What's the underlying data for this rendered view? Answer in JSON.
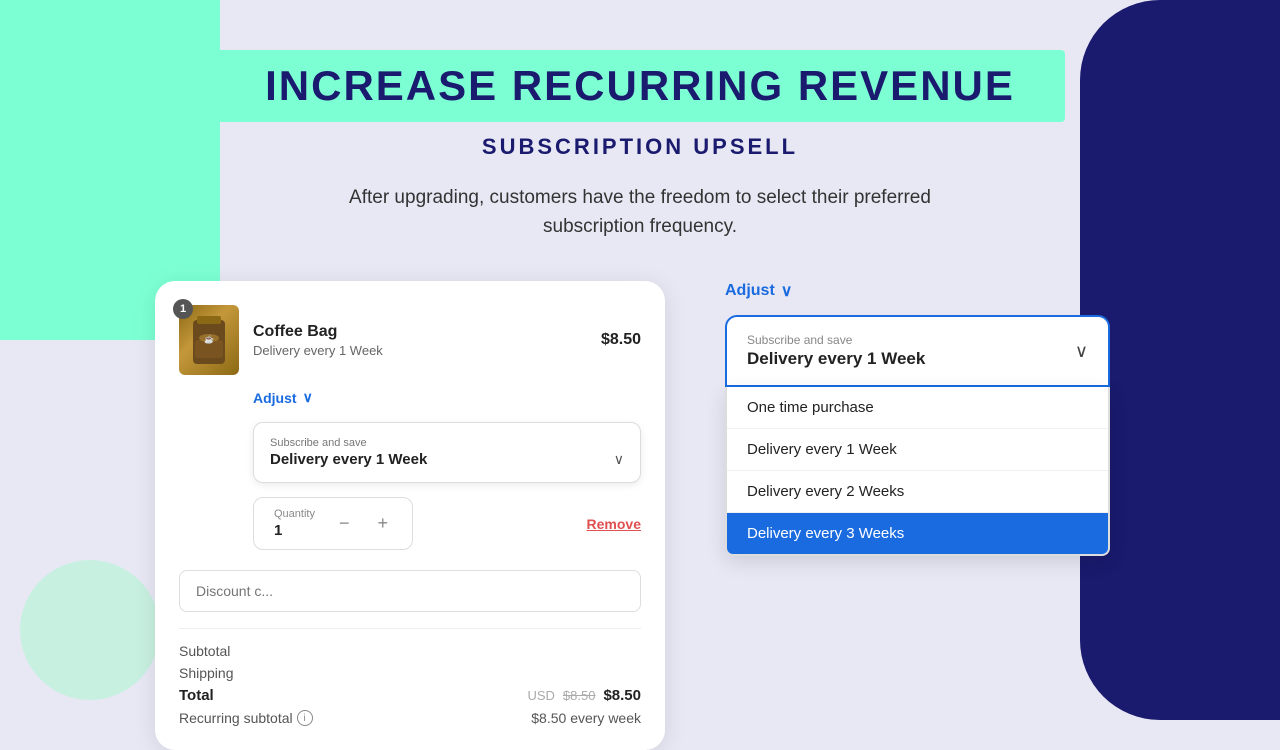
{
  "page": {
    "title": "INCREASE RECURRING REVENUE",
    "subtitle": "SUBSCRIPTION UPSELL",
    "description": "After upgrading, customers have the freedom to select their preferred subscription frequency."
  },
  "cart_card": {
    "product": {
      "badge": "1",
      "name": "Coffee Bag",
      "delivery": "Delivery every 1 Week",
      "price": "$8.50"
    },
    "adjust_label": "Adjust",
    "subscribe_section": {
      "label": "Subscribe and save",
      "value": "Delivery every 1 Week"
    },
    "quantity_section": {
      "label": "Quantity",
      "value": "1",
      "minus": "−",
      "plus": "+"
    },
    "remove_label": "Remove",
    "discount_placeholder": "Discount c...",
    "totals": {
      "subtotal_label": "Subtotal",
      "shipping_label": "Shipping",
      "total_label": "Total",
      "total_currency": "USD",
      "total_strikethrough": "$8.50",
      "total_value": "$8.50",
      "recurring_label": "Recurring subtotal",
      "recurring_value": "$8.50 every week"
    }
  },
  "right_panel": {
    "adjust_label": "Adjust",
    "dropdown": {
      "label": "Subscribe and save",
      "value": "Delivery every 1 Week"
    },
    "options": [
      {
        "label": "One time purchase",
        "selected": false
      },
      {
        "label": "Delivery every 1 Week",
        "selected": false
      },
      {
        "label": "Delivery every 2 Weeks",
        "selected": false
      },
      {
        "label": "Delivery every 3 Weeks",
        "selected": true
      }
    ]
  },
  "icons": {
    "chevron_down": "∨",
    "chevron_down_alt": "⌄",
    "info": "i",
    "minus": "−",
    "plus": "+"
  }
}
